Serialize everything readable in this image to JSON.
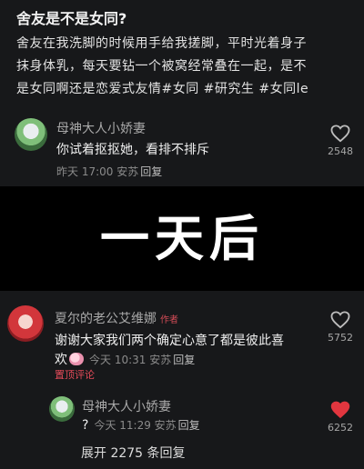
{
  "question": {
    "title": "舍友是不是女同?",
    "body_lines": [
      "舍友在我洗脚的时候用手给我搓脚，平时光着身子",
      "抹身体乳，每天要钻一个被窝经常叠在一起，是不",
      "是女同啊还是恋爱式友情#女同 #研究生 #女同le"
    ]
  },
  "comment1": {
    "name": "母神大人小娇妻",
    "text": "你试着抠抠她，看排不排斥",
    "time": "昨天 17:00 安苏",
    "reply": "回复",
    "likes": "2548"
  },
  "banner": {
    "text": "一天后"
  },
  "comment2": {
    "name": "夏尔的老公艾维娜",
    "author_tag": "作者",
    "text_line1": "谢谢大家我们两个确定心意了都是彼此喜",
    "text_line2": "欢",
    "time": "今天 10:31 安苏",
    "reply": "回复",
    "pinned": "置顶评论",
    "likes": "5752"
  },
  "reply1": {
    "name": "母神大人小娇妻",
    "text": "?",
    "time": "今天 11:29 安苏",
    "reply": "回复",
    "likes": "6252"
  },
  "expand": {
    "label": "展开 2275 条回复"
  },
  "colors": {
    "liked_heart": "#e2363f",
    "author_tag": "#d44c57"
  }
}
